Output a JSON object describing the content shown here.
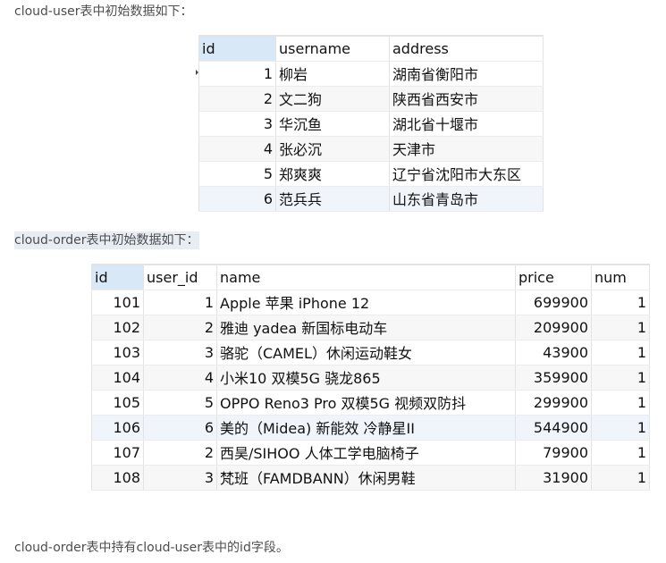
{
  "intro_user": "cloud-user表中初始数据如下：",
  "intro_order": "cloud-order表中初始数据如下：",
  "footer_text": "cloud-order表中持有cloud-user表中的id字段。",
  "user_table": {
    "columns": [
      "id",
      "username",
      "address"
    ],
    "rows": [
      [
        "1",
        "柳岩",
        "湖南省衡阳市"
      ],
      [
        "2",
        "文二狗",
        "陕西省西安市"
      ],
      [
        "3",
        "华沉鱼",
        "湖北省十堰市"
      ],
      [
        "4",
        "张必沉",
        "天津市"
      ],
      [
        "5",
        "郑爽爽",
        "辽宁省沈阳市大东区"
      ],
      [
        "6",
        "范兵兵",
        "山东省青岛市"
      ]
    ]
  },
  "order_table": {
    "columns": [
      "id",
      "user_id",
      "name",
      "price",
      "num"
    ],
    "rows": [
      [
        "101",
        "1",
        "Apple 苹果 iPhone 12",
        "699900",
        "1"
      ],
      [
        "102",
        "2",
        "雅迪 yadea 新国标电动车",
        "209900",
        "1"
      ],
      [
        "103",
        "3",
        "骆驼（CAMEL）休闲运动鞋女",
        "43900",
        "1"
      ],
      [
        "104",
        "4",
        "小米10 双模5G 骁龙865",
        "359900",
        "1"
      ],
      [
        "105",
        "5",
        "OPPO Reno3 Pro 双模5G 视频双防抖",
        "299900",
        "1"
      ],
      [
        "106",
        "6",
        "美的（Midea) 新能效 冷静星II",
        "544900",
        "1"
      ],
      [
        "107",
        "2",
        "西昊/SIHOO 人体工学电脑椅子",
        "79900",
        "1"
      ],
      [
        "108",
        "3",
        "梵班（FAMDBANN）休闲男鞋",
        "31900",
        "1"
      ]
    ]
  }
}
